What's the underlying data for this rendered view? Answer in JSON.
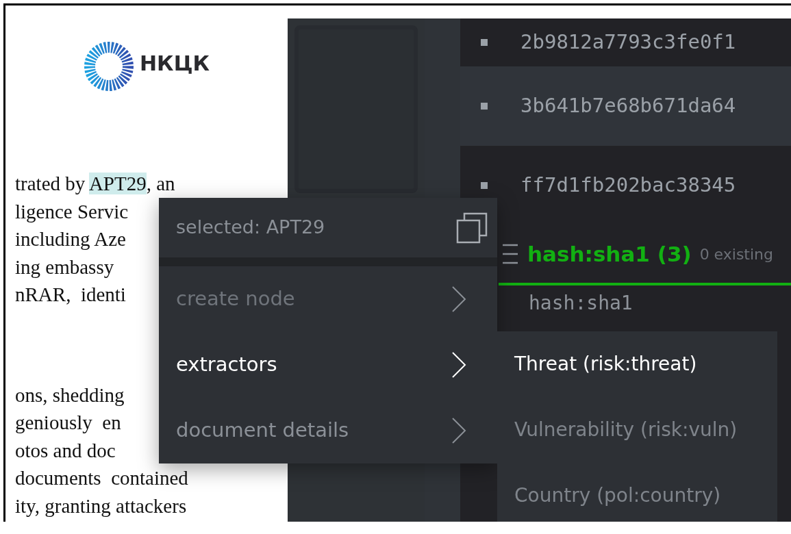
{
  "document": {
    "logo": {
      "text": "НКЦК"
    },
    "paragraphs": [
      [
        {
          "segments": [
            {
              "text": "trated by ",
              "highlighted": false
            },
            {
              "text": "APT29",
              "highlighted": true
            },
            {
              "text": ", an",
              "highlighted": false
            }
          ]
        },
        {
          "segments": [
            {
              "text": "ligence Servic",
              "highlighted": false
            }
          ]
        },
        {
          "segments": [
            {
              "text": "including Aze",
              "highlighted": false
            }
          ]
        },
        {
          "segments": [
            {
              "text": "ing embassy",
              "highlighted": false
            }
          ]
        },
        {
          "segments": [
            {
              "text": "nRAR,  identi",
              "highlighted": false
            }
          ]
        }
      ],
      [
        {
          "segments": [
            {
              "text": "ons, shedding",
              "highlighted": false
            }
          ]
        },
        {
          "segments": [
            {
              "text": "geniously  en",
              "highlighted": false
            }
          ]
        },
        {
          "segments": [
            {
              "text": "otos and doc",
              "highlighted": false
            }
          ]
        },
        {
          "segments": [
            {
              "text": "documents  contained",
              "highlighted": false
            }
          ]
        },
        {
          "segments": [
            {
              "text": "ity, granting attackers",
              "highlighted": false
            }
          ]
        }
      ]
    ]
  },
  "hash_list": {
    "rows": [
      {
        "text": "2b9812a7793c3fe0f1",
        "highlighted": false
      },
      {
        "text": "3b641b7e68b671da64",
        "highlighted": true
      },
      {
        "text": "ff7d1fb202bac38345",
        "highlighted": false
      }
    ],
    "section": {
      "title": "hash:sha1 (3)",
      "note": "0 existing",
      "column": "hash:sha1"
    }
  },
  "context_menu": {
    "header": "selected: APT29",
    "items": [
      {
        "label": "create node",
        "selected": false,
        "disabled": true
      },
      {
        "label": "extractors",
        "selected": true,
        "disabled": false
      },
      {
        "label": "document details",
        "selected": false,
        "disabled": false
      }
    ]
  },
  "submenu": {
    "items": [
      {
        "label": "Threat (risk:threat)",
        "selected": true
      },
      {
        "label": "Vulnerability (risk:vuln)",
        "selected": false
      },
      {
        "label": "Country (pol:country)",
        "selected": false
      }
    ]
  }
}
